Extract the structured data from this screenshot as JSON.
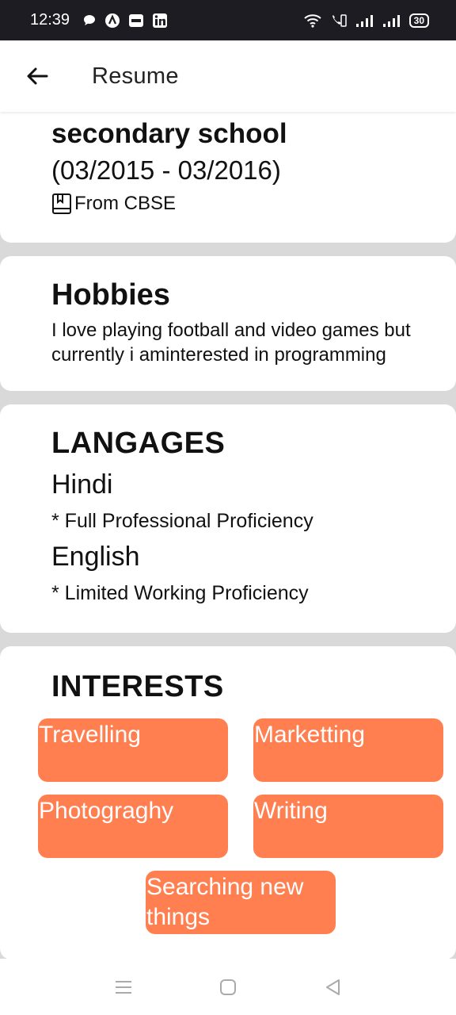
{
  "status_bar": {
    "time": "12:39",
    "battery": "30",
    "icons": [
      "chat-bubble-icon",
      "app-a-icon",
      "paytm-icon",
      "linkedin-icon",
      "wifi-icon",
      "volte-icon",
      "signal-icon",
      "signal-icon"
    ]
  },
  "appbar": {
    "title": "Resume",
    "back_icon": "arrow-left-icon"
  },
  "education": {
    "title": "secondary school",
    "dates": "(03/2015 - 03/2016)",
    "from": "From CBSE",
    "icon": "book-icon"
  },
  "hobbies": {
    "title": "Hobbies",
    "text": "I love playing football and video games but currently i aminterested in programming"
  },
  "languages": {
    "title": "LANGAGES",
    "items": [
      {
        "name": "Hindi",
        "level": "* Full Professional Proficiency"
      },
      {
        "name": "English",
        "level": "* Limited Working Proficiency"
      }
    ]
  },
  "interests": {
    "title": "INTERESTS",
    "items": [
      "Travelling",
      "Marketting",
      "Photograghy",
      "Writing",
      "Searching new things"
    ],
    "chip_color": "#ff7f50"
  },
  "nav_bar": {
    "icons": [
      "menu-icon",
      "home-icon",
      "back-icon"
    ]
  }
}
